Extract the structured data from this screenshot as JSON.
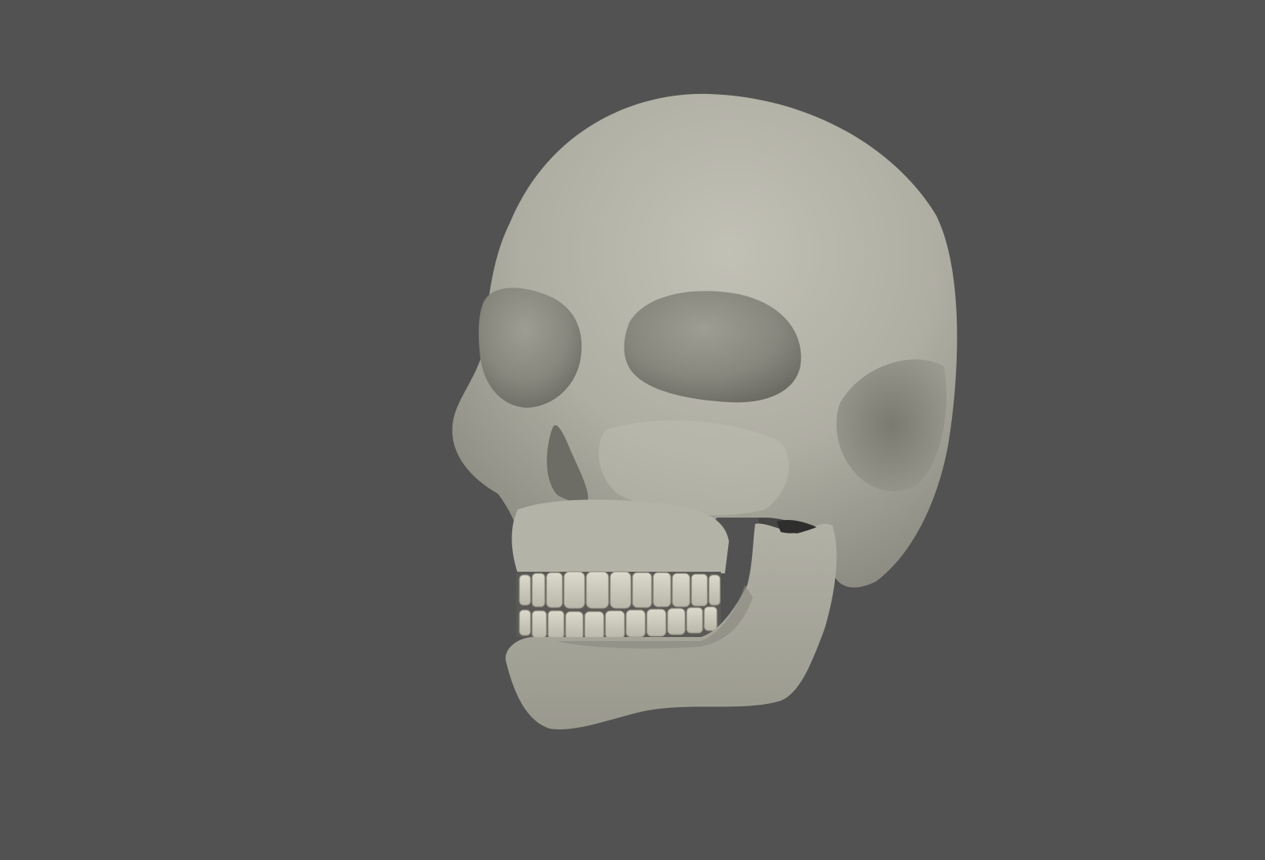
{
  "scene": {
    "background_color": "#525252",
    "object": "skull-3d-render",
    "bone_color": "#b9b8ad",
    "bone_shadow_color": "#7d7c73",
    "bone_highlight_color": "#d6d5cb",
    "cavity_color": "#6a6962",
    "teeth_color": "#d2d0c2",
    "jaw_state": "open"
  }
}
